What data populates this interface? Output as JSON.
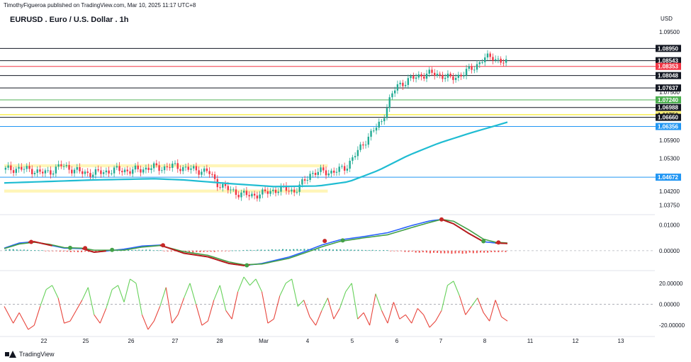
{
  "header": {
    "publisher": "TimothyFigueroa published on TradingView.com, Mar 10, 2025 11:17 UTC+8"
  },
  "instrument": {
    "title": "EURUSD . Euro / U.S. Dollar . 1h",
    "currency": "USD"
  },
  "footer": {
    "brand": "TradingView"
  },
  "colors": {
    "ema": "#1fbcd2",
    "zone": "#fff5b8",
    "up": "#22ab94",
    "down": "#f23645",
    "macd": "#2962ff",
    "signal": "#43a047",
    "hist_up": "#26a69a",
    "hist_down": "#ef5350"
  },
  "chart_data": [
    {
      "type": "candlestick",
      "pane": "price",
      "title": "EURUSD . Euro / U.S. Dollar . 1h",
      "ylabel": "USD",
      "ylim": [
        1.0345,
        1.099
      ],
      "y_ticks": [
        "1.09500",
        "1.07500",
        "1.05900",
        "1.05300",
        "1.04200",
        "1.03750"
      ],
      "x_ticks": [
        "22",
        "25",
        "26",
        "27",
        "28",
        "Mar",
        "4",
        "5",
        "6",
        "7",
        "8",
        "11",
        "12",
        "13"
      ],
      "price_path": [
        [
          0,
          1.0492
        ],
        [
          4,
          1.0496
        ],
        [
          9,
          1.0492
        ],
        [
          12,
          1.0482
        ],
        [
          15,
          1.0484
        ],
        [
          19,
          1.0506
        ],
        [
          22,
          1.0496
        ],
        [
          26,
          1.0482
        ],
        [
          30,
          1.048
        ],
        [
          34,
          1.0486
        ],
        [
          38,
          1.0492
        ],
        [
          42,
          1.0488
        ],
        [
          46,
          1.0494
        ],
        [
          50,
          1.05
        ],
        [
          53,
          1.0498
        ],
        [
          56,
          1.0504
        ],
        [
          59,
          1.05
        ],
        [
          62,
          1.0494
        ],
        [
          65,
          1.049
        ],
        [
          68,
          1.0486
        ],
        [
          71,
          1.0448
        ],
        [
          74,
          1.043
        ],
        [
          78,
          1.0414
        ],
        [
          82,
          1.0406
        ],
        [
          86,
          1.0412
        ],
        [
          90,
          1.0424
        ],
        [
          94,
          1.0428
        ],
        [
          97,
          1.042
        ],
        [
          99,
          1.044
        ],
        [
          102,
          1.0478
        ],
        [
          106,
          1.0486
        ],
        [
          110,
          1.0484
        ],
        [
          114,
          1.05
        ],
        [
          118,
          1.0552
        ],
        [
          122,
          1.0608
        ],
        [
          126,
          1.0652
        ],
        [
          128,
          1.071
        ],
        [
          131,
          1.077
        ],
        [
          135,
          1.079
        ],
        [
          139,
          1.0806
        ],
        [
          143,
          1.0812
        ],
        [
          146,
          1.0806
        ],
        [
          149,
          1.0794
        ],
        [
          153,
          1.081
        ],
        [
          157,
          1.0834
        ],
        [
          160,
          1.086
        ],
        [
          163,
          1.0868
        ],
        [
          166,
          1.085
        ],
        [
          168,
          1.0846
        ]
      ],
      "levels": [
        {
          "value": 1.0895,
          "label": "1.08950",
          "line": "#131722",
          "box_bg": "#131722",
          "box_fg": "#ffffff"
        },
        {
          "value": 1.08543,
          "label": "1.08543",
          "line": "#131722",
          "box_bg": "#131722",
          "box_fg": "#ffffff"
        },
        {
          "value": 1.08353,
          "label": "1.08353",
          "line": "#f23645",
          "box_bg": "#f23645",
          "box_fg": "#ffffff"
        },
        {
          "value": 1.08048,
          "label": "1.08048",
          "line": "#131722",
          "box_bg": "#131722",
          "box_fg": "#ffffff"
        },
        {
          "value": 1.07637,
          "label": "1.07637",
          "line": "#131722",
          "box_bg": "#131722",
          "box_fg": "#ffffff"
        },
        {
          "value": 1.0724,
          "label": "1.07240",
          "line": "#4caf50",
          "box_bg": "#4caf50",
          "box_fg": "#ffffff"
        },
        {
          "value": 1.06988,
          "label": "1.06988",
          "line": "#131722",
          "box_bg": "#131722",
          "box_fg": "#ffffff"
        },
        {
          "value": 1.0675,
          "label": "1.06750",
          "line": "#f7e600",
          "box_bg": "#fff176",
          "box_fg": "#131722"
        },
        {
          "value": 1.0666,
          "label": "1.06660",
          "line": "#131722",
          "box_bg": "#131722",
          "box_fg": "#ffffff"
        },
        {
          "value": 1.06356,
          "label": "1.06356",
          "line": "#2196f3",
          "box_bg": "#2196f3",
          "box_fg": "#ffffff"
        },
        {
          "value": 1.04672,
          "label": "1.04672",
          "line": "#2196f3",
          "box_bg": "#2196f3",
          "box_fg": "#ffffff"
        }
      ],
      "zones": [
        {
          "from": 1.05,
          "to": 1.051,
          "x_end": 108
        },
        {
          "from": 1.0416,
          "to": 1.0426,
          "x_end": 108
        }
      ],
      "ema": [
        [
          0,
          1.0448
        ],
        [
          30,
          1.0458
        ],
        [
          50,
          1.0462
        ],
        [
          60,
          1.0458
        ],
        [
          75,
          1.0446
        ],
        [
          90,
          1.0436
        ],
        [
          105,
          1.0438
        ],
        [
          115,
          1.0452
        ],
        [
          125,
          1.049
        ],
        [
          135,
          1.054
        ],
        [
          145,
          1.058
        ],
        [
          155,
          1.0612
        ],
        [
          168,
          1.065
        ]
      ]
    },
    {
      "type": "line",
      "pane": "macd",
      "ylim": [
        -0.0075,
        0.0135
      ],
      "y_ticks": [
        "0.01000",
        "0.00000"
      ],
      "series": [
        {
          "role": "macd",
          "values": [
            [
              0,
              0.001
            ],
            [
              5,
              0.003
            ],
            [
              10,
              0.0035
            ],
            [
              15,
              0.0022
            ],
            [
              20,
              0.001
            ],
            [
              26,
              0.0008
            ],
            [
              30,
              -0.0006
            ],
            [
              40,
              0.0006
            ],
            [
              46,
              0.0018
            ],
            [
              52,
              0.0022
            ],
            [
              60,
              -0.001
            ],
            [
              68,
              -0.0024
            ],
            [
              75,
              -0.005
            ],
            [
              80,
              -0.0058
            ],
            [
              86,
              -0.005
            ],
            [
              95,
              -0.0025
            ],
            [
              100,
              -0.0005
            ],
            [
              106,
              0.0022
            ],
            [
              112,
              0.0042
            ],
            [
              120,
              0.0055
            ],
            [
              128,
              0.007
            ],
            [
              136,
              0.0098
            ],
            [
              142,
              0.0116
            ],
            [
              146,
              0.0122
            ],
            [
              150,
              0.0105
            ],
            [
              155,
              0.0068
            ],
            [
              160,
              0.0035
            ],
            [
              164,
              0.003
            ],
            [
              168,
              0.0028
            ]
          ]
        },
        {
          "role": "signal",
          "values": [
            [
              0,
              0.0008
            ],
            [
              5,
              0.0026
            ],
            [
              10,
              0.0033
            ],
            [
              15,
              0.0025
            ],
            [
              20,
              0.0012
            ],
            [
              26,
              0.001
            ],
            [
              30,
              0.0002
            ],
            [
              40,
              0.0002
            ],
            [
              46,
              0.0014
            ],
            [
              52,
              0.002
            ],
            [
              60,
              -0.0004
            ],
            [
              68,
              -0.0018
            ],
            [
              75,
              -0.0044
            ],
            [
              80,
              -0.0055
            ],
            [
              86,
              -0.0052
            ],
            [
              95,
              -0.003
            ],
            [
              100,
              -0.001
            ],
            [
              106,
              0.0015
            ],
            [
              112,
              0.0036
            ],
            [
              120,
              0.005
            ],
            [
              128,
              0.0062
            ],
            [
              136,
              0.009
            ],
            [
              142,
              0.011
            ],
            [
              146,
              0.0122
            ],
            [
              150,
              0.0115
            ],
            [
              155,
              0.0082
            ],
            [
              160,
              0.0045
            ],
            [
              164,
              0.0033
            ],
            [
              168,
              0.003
            ]
          ]
        }
      ],
      "histogram": [
        0.0006,
        0.0004,
        0.0002,
        -0.0002,
        -0.0004,
        -0.0006,
        -0.0005,
        -0.0003,
        0.0001,
        0.0003,
        0.0004,
        0.0002,
        -0.0003,
        -0.0006,
        -0.0007,
        -0.0005,
        -0.0002,
        0.0001,
        0.0003,
        0.0004,
        0.0005,
        0.0006,
        0.0007,
        0.0007,
        0.0006,
        0.0005,
        0.0004,
        0.0003,
        0.0002,
        -0.0002,
        -0.0005,
        -0.0008,
        -0.001,
        -0.0012,
        -0.0012,
        -0.001,
        -0.0008,
        -0.0006
      ],
      "cross_markers": [
        {
          "x": 9,
          "value": 0.0034,
          "color": "#c62828"
        },
        {
          "x": 22,
          "value": 0.0011,
          "color": "#43a047"
        },
        {
          "x": 27,
          "value": 0.001,
          "color": "#c62828"
        },
        {
          "x": 36,
          "value": 0.0003,
          "color": "#43a047"
        },
        {
          "x": 53,
          "value": 0.0021,
          "color": "#c62828"
        },
        {
          "x": 81,
          "value": -0.0057,
          "color": "#43a047"
        },
        {
          "x": 107,
          "value": 0.0038,
          "color": "#c62828"
        },
        {
          "x": 113,
          "value": 0.004,
          "color": "#43a047"
        },
        {
          "x": 146,
          "value": 0.0122,
          "color": "#c62828"
        },
        {
          "x": 160,
          "value": 0.0037,
          "color": "#43a047"
        },
        {
          "x": 165,
          "value": 0.0032,
          "color": "#c62828"
        }
      ]
    },
    {
      "type": "line",
      "pane": "oscillator",
      "ylim": [
        -30,
        30
      ],
      "y_ticks": [
        "20.00000",
        "0.00000",
        "-20.00000"
      ],
      "values": [
        [
          0,
          -2
        ],
        [
          3,
          -18
        ],
        [
          5,
          -8
        ],
        [
          8,
          -24
        ],
        [
          10,
          -20
        ],
        [
          12,
          -2
        ],
        [
          14,
          14
        ],
        [
          16,
          18
        ],
        [
          18,
          6
        ],
        [
          20,
          -18
        ],
        [
          22,
          -16
        ],
        [
          24,
          -6
        ],
        [
          26,
          4
        ],
        [
          28,
          16
        ],
        [
          30,
          -10
        ],
        [
          32,
          -18
        ],
        [
          34,
          -4
        ],
        [
          36,
          14
        ],
        [
          38,
          18
        ],
        [
          40,
          2
        ],
        [
          42,
          24
        ],
        [
          44,
          20
        ],
        [
          46,
          -10
        ],
        [
          48,
          -24
        ],
        [
          50,
          -16
        ],
        [
          52,
          -2
        ],
        [
          54,
          16
        ],
        [
          56,
          -18
        ],
        [
          58,
          -10
        ],
        [
          60,
          6
        ],
        [
          62,
          20
        ],
        [
          64,
          0
        ],
        [
          66,
          -20
        ],
        [
          68,
          -16
        ],
        [
          70,
          4
        ],
        [
          72,
          18
        ],
        [
          74,
          -6
        ],
        [
          76,
          -14
        ],
        [
          78,
          12
        ],
        [
          80,
          26
        ],
        [
          82,
          18
        ],
        [
          84,
          24
        ],
        [
          86,
          12
        ],
        [
          88,
          -18
        ],
        [
          90,
          -14
        ],
        [
          92,
          8
        ],
        [
          94,
          20
        ],
        [
          96,
          24
        ],
        [
          98,
          -2
        ],
        [
          100,
          4
        ],
        [
          102,
          -12
        ],
        [
          104,
          -20
        ],
        [
          106,
          -6
        ],
        [
          108,
          6
        ],
        [
          110,
          -14
        ],
        [
          112,
          -4
        ],
        [
          114,
          12
        ],
        [
          116,
          20
        ],
        [
          118,
          -14
        ],
        [
          120,
          -8
        ],
        [
          122,
          -20
        ],
        [
          124,
          10
        ],
        [
          126,
          -6
        ],
        [
          128,
          -18
        ],
        [
          130,
          2
        ],
        [
          132,
          -14
        ],
        [
          134,
          -10
        ],
        [
          136,
          -18
        ],
        [
          138,
          -4
        ],
        [
          140,
          -10
        ],
        [
          142,
          -22
        ],
        [
          144,
          -16
        ],
        [
          146,
          -6
        ],
        [
          148,
          18
        ],
        [
          150,
          22
        ],
        [
          152,
          8
        ],
        [
          154,
          -10
        ],
        [
          156,
          -2
        ],
        [
          158,
          6
        ],
        [
          160,
          -8
        ],
        [
          162,
          -16
        ],
        [
          164,
          4
        ],
        [
          166,
          -12
        ],
        [
          168,
          -16
        ]
      ]
    }
  ]
}
